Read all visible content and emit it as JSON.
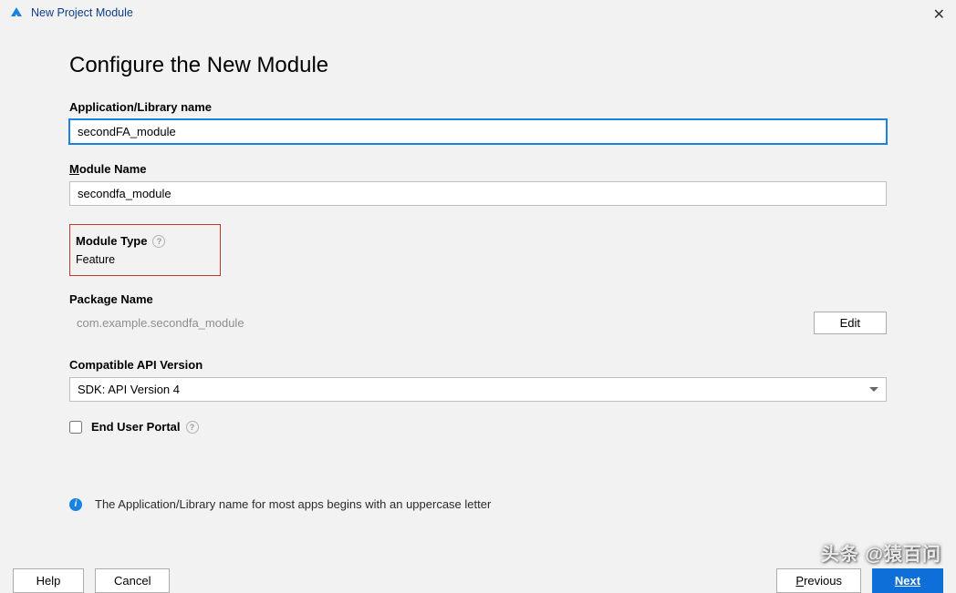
{
  "titlebar": {
    "title": "New Project Module"
  },
  "heading": "Configure the New Module",
  "fields": {
    "app_lib_name": {
      "label": "Application/Library name",
      "value": "secondFA_module"
    },
    "module_name": {
      "label_prefix": "M",
      "label_rest": "odule Name",
      "value": "secondfa_module"
    },
    "module_type": {
      "label": "Module Type",
      "value": "Feature"
    },
    "package_name": {
      "label": "Package Name",
      "value": "com.example.secondfa_module",
      "edit_label": "Edit"
    },
    "api_version": {
      "label": "Compatible API Version",
      "selected": "SDK: API Version 4"
    },
    "end_user_portal": {
      "label": "End User Portal",
      "checked": false
    }
  },
  "info": {
    "text": "The Application/Library name for most apps begins with an uppercase letter"
  },
  "footer": {
    "help": "Help",
    "cancel": "Cancel",
    "previous_u": "P",
    "previous_rest": "revious",
    "next_u": "N",
    "next_rest": "ext"
  },
  "watermark": "头条 @猿百问"
}
